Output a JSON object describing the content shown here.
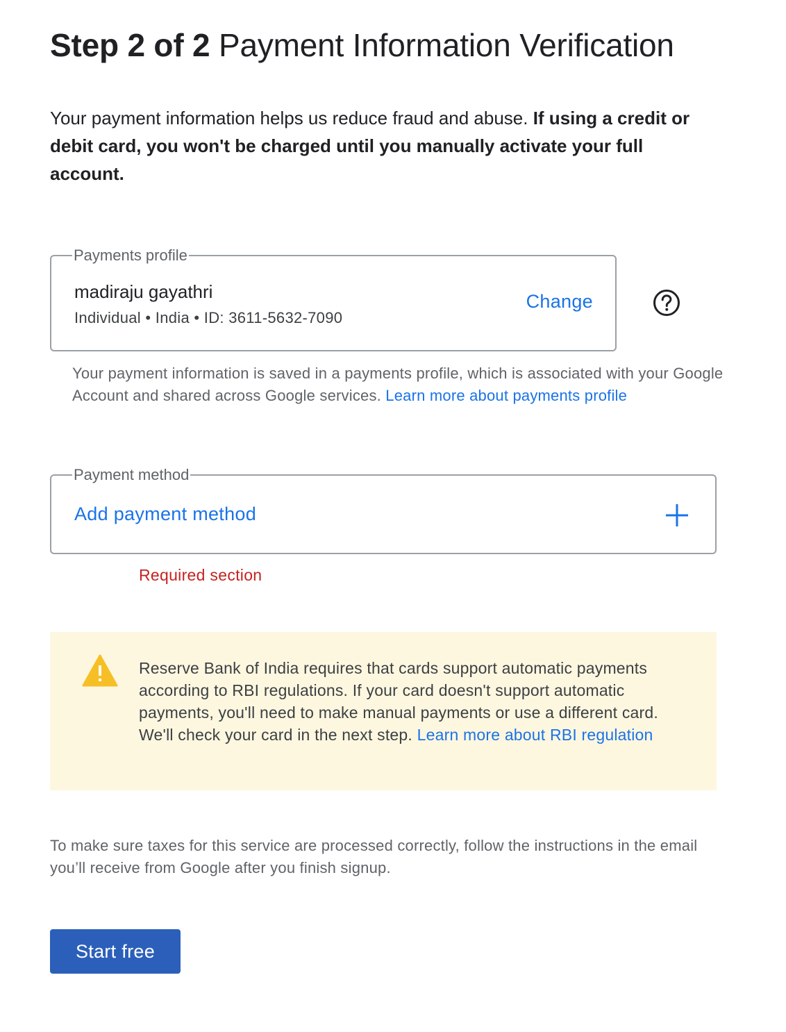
{
  "header": {
    "step_label": "Step 2 of 2",
    "title": "Payment Information Verification"
  },
  "intro": {
    "text": "Your payment information helps us reduce fraud and abuse. ",
    "bold_text": "If using a credit or debit card, you won't be charged until you manually activate your full account."
  },
  "payments_profile": {
    "legend": "Payments profile",
    "name": "madiraju gayathri",
    "meta": "Individual • India • ID: 3611-5632-7090",
    "change_label": "Change",
    "help_icon": "help-circle-icon",
    "note": "Your payment information is saved in a payments profile, which is associated with your Google Account and shared across Google services. ",
    "note_link": "Learn more about payments profile"
  },
  "payment_method": {
    "legend": "Payment method",
    "add_label": "Add payment method",
    "add_icon": "plus-icon",
    "error": "Required section"
  },
  "warning": {
    "icon": "warning-triangle-icon",
    "text": "Reserve Bank of India requires that cards support automatic payments according to RBI regulations. If your card doesn't support automatic payments, you'll need to make manual payments or use a different card. We'll check your card in the next step. ",
    "link": "Learn more about RBI regulation"
  },
  "tax_note": "To make sure taxes for this service are processed correctly, follow the instructions in the email you’ll receive from Google after you finish signup.",
  "start_button": "Start free",
  "colors": {
    "link": "#1a73e8",
    "error": "#c5221f",
    "primary_button": "#2c5fba",
    "warning_bg": "#fef7e0",
    "warning_icon": "#f6bf26"
  }
}
